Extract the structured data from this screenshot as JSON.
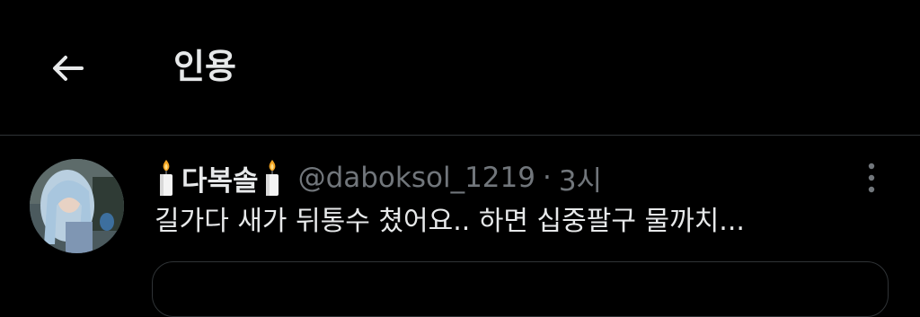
{
  "header": {
    "title": "인용",
    "back_icon": "arrow-left-icon"
  },
  "tweet": {
    "display_name": "다복솔",
    "name_emoji": "candle-icon",
    "handle": "@daboksol_1219",
    "separator": "·",
    "time": "3시",
    "text": "길가다 새가 뒤통수 쳤어요.. 하면 십중팔구 물까치...",
    "more_icon": "more-vertical-icon"
  },
  "colors": {
    "background": "#000000",
    "primary_text": "#e7e9ea",
    "secondary_text": "#71767b",
    "border": "#2f3336"
  }
}
